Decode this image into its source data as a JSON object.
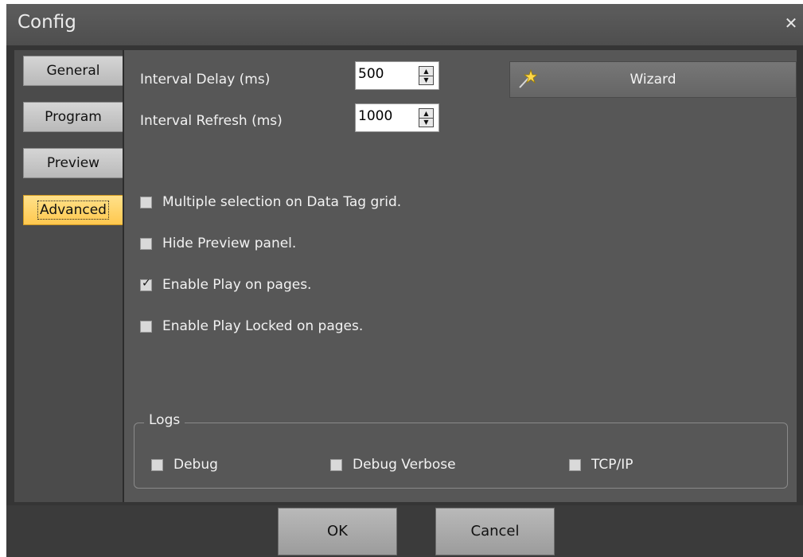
{
  "window": {
    "title": "Config",
    "close_icon": "close-icon"
  },
  "nav": {
    "items": [
      {
        "label": "General",
        "active": false
      },
      {
        "label": "Program",
        "active": false
      },
      {
        "label": "Preview",
        "active": false
      },
      {
        "label": "Advanced",
        "active": true
      }
    ]
  },
  "settings": {
    "interval_delay_label": "Interval Delay (ms)",
    "interval_delay_value": "500",
    "interval_refresh_label": "Interval Refresh (ms)",
    "interval_refresh_value": "1000",
    "wizard_label": "Wizard",
    "wizard_icon": "magic-wand-icon"
  },
  "options": [
    {
      "label": "Multiple selection on Data Tag grid.",
      "checked": false
    },
    {
      "label": "Hide Preview panel.",
      "checked": false
    },
    {
      "label": "Enable Play on pages.",
      "checked": true
    },
    {
      "label": "Enable Play Locked on pages.",
      "checked": false
    }
  ],
  "logs": {
    "title": "Logs",
    "items": [
      {
        "label": "Debug",
        "checked": false
      },
      {
        "label": "Debug Verbose",
        "checked": false
      },
      {
        "label": "TCP/IP",
        "checked": false
      }
    ]
  },
  "footer": {
    "ok_label": "OK",
    "cancel_label": "Cancel"
  },
  "colors": {
    "active_tab": "#ffc84f",
    "background": "#353535",
    "panel": "#575757"
  }
}
